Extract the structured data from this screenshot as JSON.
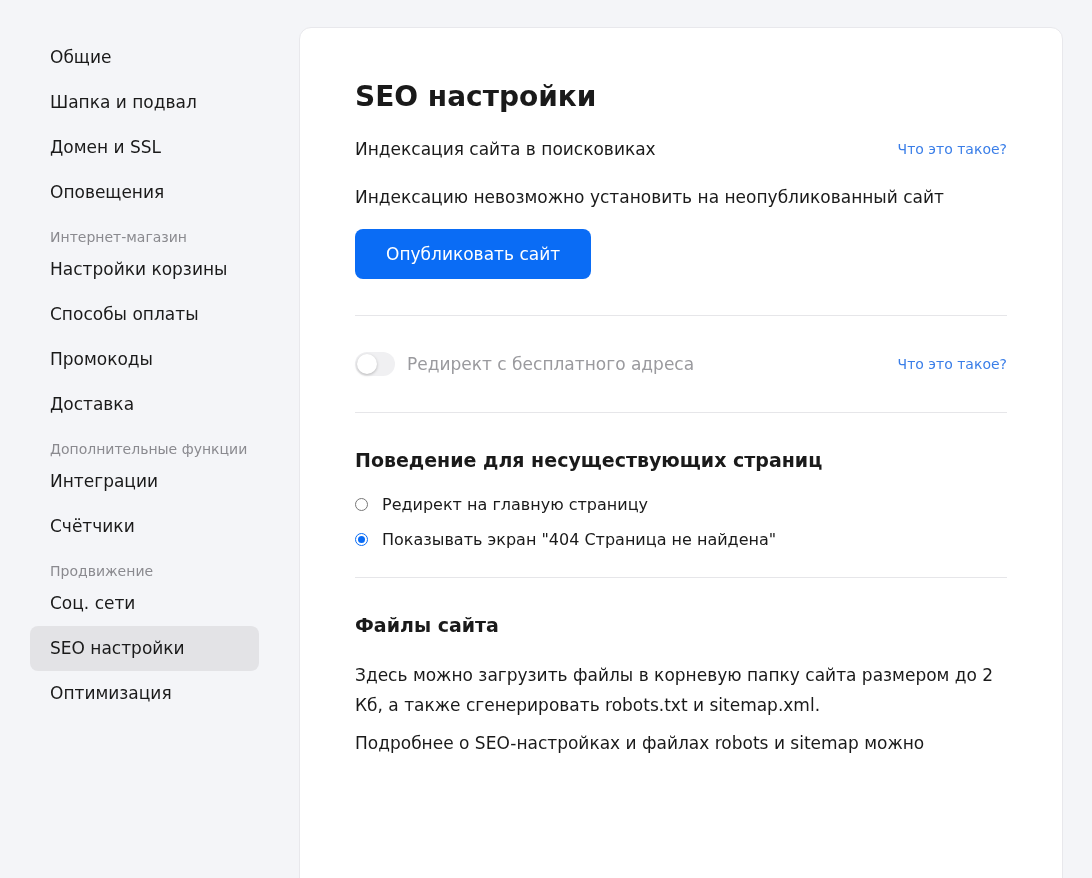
{
  "sidebar": {
    "sections": [
      {
        "items": [
          {
            "label": "Общие",
            "selected": false
          },
          {
            "label": "Шапка и подвал",
            "selected": false
          },
          {
            "label": "Домен и SSL",
            "selected": false
          },
          {
            "label": "Оповещения",
            "selected": false
          }
        ]
      },
      {
        "heading": "Интернет-магазин",
        "items": [
          {
            "label": "Настройки корзины",
            "selected": false
          },
          {
            "label": "Способы оплаты",
            "selected": false
          },
          {
            "label": "Промокоды",
            "selected": false
          },
          {
            "label": "Доставка",
            "selected": false
          }
        ]
      },
      {
        "heading": "Дополнительные функции",
        "items": [
          {
            "label": "Интеграции",
            "selected": false
          },
          {
            "label": "Счётчики",
            "selected": false
          }
        ]
      },
      {
        "heading": "Продвижение",
        "items": [
          {
            "label": "Соц. сети",
            "selected": false
          },
          {
            "label": "SEO настройки",
            "selected": true
          },
          {
            "label": "Оптимизация",
            "selected": false
          }
        ]
      }
    ]
  },
  "page": {
    "title": "SEO настройки",
    "indexing": {
      "label": "Индексация сайта в поисковиках",
      "help_link": "Что это такое?",
      "notice": "Индексацию невозможно установить на неопубликованный сайт",
      "button": "Опубликовать сайт"
    },
    "redirect": {
      "label": "Редирект с бесплатного адреса",
      "on": false,
      "disabled": true,
      "help_link": "Что это такое?"
    },
    "not_found": {
      "title": "Поведение для несуществующих страниц",
      "options": [
        {
          "label": "Редирект на главную страницу",
          "selected": false
        },
        {
          "label": "Показывать экран \"404 Страница не найдена\"",
          "selected": true
        }
      ]
    },
    "files": {
      "title": "Файлы сайта",
      "paragraphs": [
        "Здесь можно загрузить файлы в корневую папку сайта размером до 2 Кб, а также сгенерировать robots.txt и sitemap.xml.",
        "Подробнее о SEO-настройках и файлах robots и sitemap можно"
      ]
    }
  }
}
